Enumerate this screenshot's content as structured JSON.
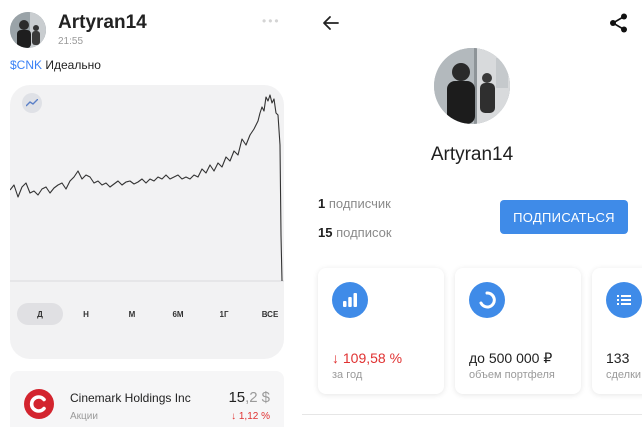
{
  "post": {
    "author": "Artyran14",
    "time": "21:55",
    "ticker": "$CNK",
    "text": "Идеально"
  },
  "chart": {
    "periods": [
      "Д",
      "Н",
      "М",
      "6М",
      "1Г",
      "ВСЕ"
    ],
    "active_period": "Д",
    "line_color": "#333333"
  },
  "instrument": {
    "name": "Cinemark Holdings Inc",
    "type": "Акции",
    "price_int": "15",
    "price_dec": ",2",
    "currency": "$",
    "change": "↓ 1,12 %",
    "change_color": "#e03131"
  },
  "profile": {
    "name": "Artyran14",
    "subscribers_count": "1",
    "subscribers_label": "подписчик",
    "subscriptions_count": "15",
    "subscriptions_label": "подписок",
    "subscribe_button": "ПОДПИСАТЬСЯ",
    "accent": "#3f8be8"
  },
  "metrics": [
    {
      "icon": "bar-chart-icon",
      "value": "↓ 109,58 %",
      "caption": "за год",
      "negative": true
    },
    {
      "icon": "pie-chart-icon",
      "value": "до 500 000 ₽",
      "caption": "объем портфеля",
      "negative": false
    },
    {
      "icon": "list-icon",
      "value": "133",
      "caption": "сделки",
      "negative": false
    }
  ]
}
